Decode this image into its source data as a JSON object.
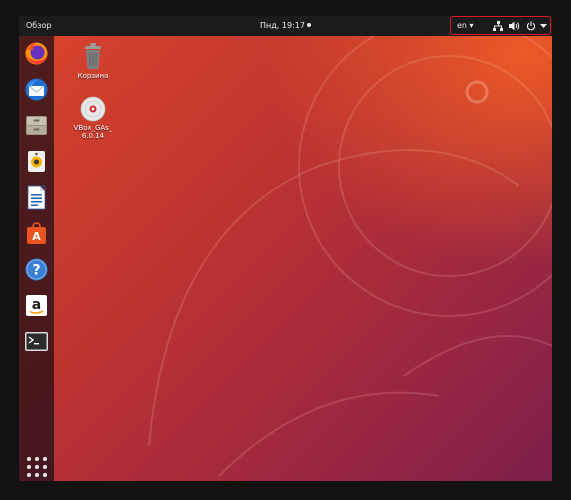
{
  "topbar": {
    "activities_label": "Обзор",
    "clock_label": "Пнд, 19:17",
    "tray": {
      "lang_label": "en ▾",
      "icons": [
        "network-icon",
        "volume-icon",
        "power-icon",
        "chevron-down-icon"
      ]
    }
  },
  "dock": {
    "items": [
      {
        "icon": "firefox-icon",
        "app": "Firefox"
      },
      {
        "icon": "thunderbird-icon",
        "app": "Thunderbird"
      },
      {
        "icon": "files-icon",
        "app": "Files"
      },
      {
        "icon": "rhythmbox-icon",
        "app": "Rhythmbox"
      },
      {
        "icon": "libreoffice-writer-icon",
        "app": "LibreOffice Writer"
      },
      {
        "icon": "software-center-icon",
        "app": "Ubuntu Software"
      },
      {
        "icon": "help-icon",
        "app": "Help"
      },
      {
        "icon": "amazon-icon",
        "app": "Amazon"
      },
      {
        "icon": "terminal-icon",
        "app": "Terminal"
      }
    ],
    "show_apps_icon": "apps-grid-icon"
  },
  "desktop": {
    "icons": [
      {
        "label": "Корзина",
        "icon": "trash-icon"
      },
      {
        "label": "VBox_GAs_ 6.0.14",
        "icon": "cd-icon"
      }
    ]
  },
  "colors": {
    "accent_orange": "#e95420",
    "topbar_bg": "#1b1b1b",
    "highlight_red": "#d8172a"
  }
}
